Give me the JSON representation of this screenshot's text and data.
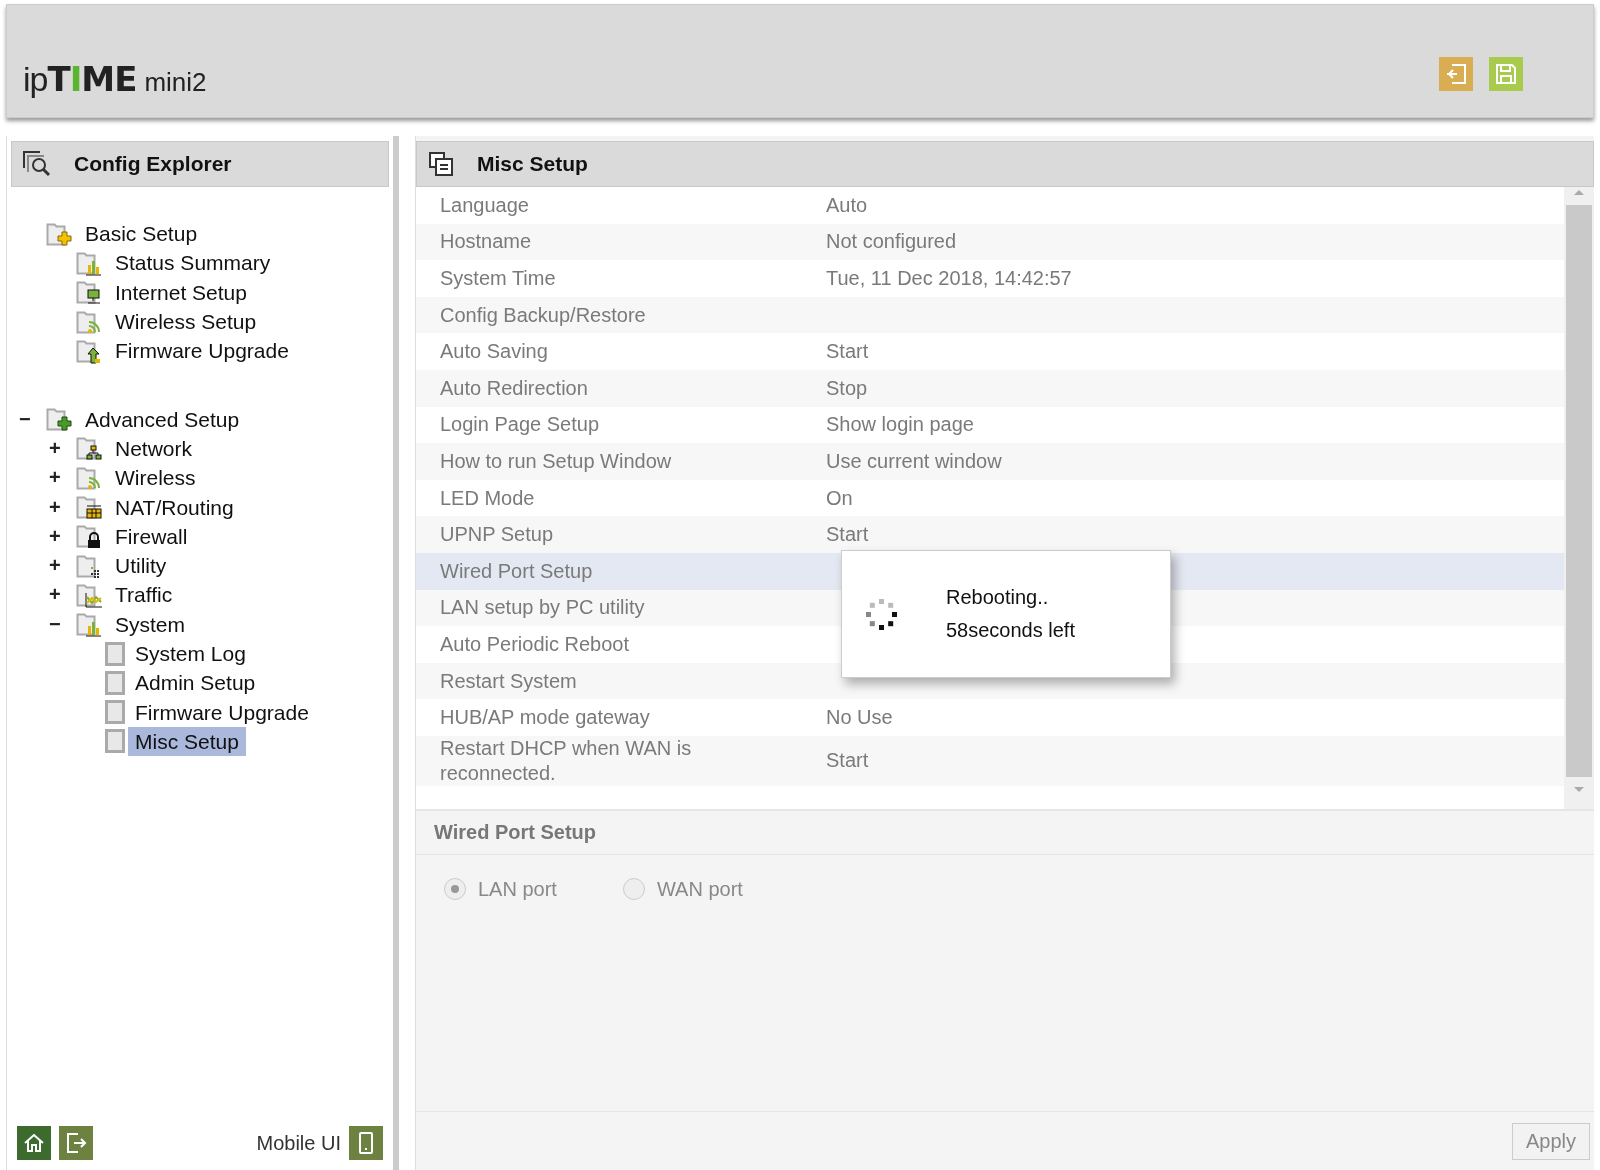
{
  "logo": {
    "prefix": "ip",
    "name": "TIME",
    "model": "mini2"
  },
  "explorer": {
    "title": "Config Explorer",
    "tree": [
      {
        "label": "Basic Setup",
        "kind": "basic",
        "selected": false,
        "children": [
          {
            "label": "Status Summary",
            "kind": "chart",
            "selected": false
          },
          {
            "label": "Internet Setup",
            "kind": "monitor",
            "selected": false
          },
          {
            "label": "Wireless Setup",
            "kind": "signal",
            "selected": false
          },
          {
            "label": "Firmware Upgrade",
            "kind": "upload",
            "selected": false
          }
        ]
      },
      {
        "label": "Advanced Setup",
        "kind": "advanced",
        "selected": false,
        "toggle": "−",
        "children": [
          {
            "label": "Network",
            "kind": "network",
            "selected": false,
            "toggle": "+"
          },
          {
            "label": "Wireless",
            "kind": "signal",
            "selected": false,
            "toggle": "+"
          },
          {
            "label": "NAT/Routing",
            "kind": "nat",
            "selected": false,
            "toggle": "+"
          },
          {
            "label": "Firewall",
            "kind": "lock",
            "selected": false,
            "toggle": "+"
          },
          {
            "label": "Utility",
            "kind": "utility",
            "selected": false,
            "toggle": "+"
          },
          {
            "label": "Traffic",
            "kind": "traffic",
            "selected": false,
            "toggle": "+"
          },
          {
            "label": "System",
            "kind": "chart",
            "selected": false,
            "toggle": "−",
            "children": [
              {
                "label": "System Log",
                "kind": "page",
                "selected": false
              },
              {
                "label": "Admin Setup",
                "kind": "page",
                "selected": false
              },
              {
                "label": "Firmware Upgrade",
                "kind": "page",
                "selected": false
              },
              {
                "label": "Misc Setup",
                "kind": "page",
                "selected": true
              }
            ]
          }
        ]
      }
    ],
    "mobile_label": "Mobile UI"
  },
  "panel": {
    "title": "Misc Setup",
    "rows": [
      {
        "label": "Language",
        "value": "Auto",
        "selected": false
      },
      {
        "label": "Hostname",
        "value": "Not configured",
        "selected": false
      },
      {
        "label": "System Time",
        "value": "Tue, 11 Dec 2018, 14:42:57",
        "selected": false
      },
      {
        "label": "Config Backup/Restore",
        "selected": false
      },
      {
        "label": "Auto Saving",
        "value": "Start",
        "selected": false
      },
      {
        "label": "Auto Redirection",
        "value": "Stop",
        "selected": false
      },
      {
        "label": "Login Page Setup",
        "value": "Show login page",
        "selected": false
      },
      {
        "label": "How to run Setup Window",
        "value": "Use current window",
        "selected": false
      },
      {
        "label": "LED Mode",
        "value": "On",
        "selected": false
      },
      {
        "label": "UPNP Setup",
        "value": "Start",
        "selected": false
      },
      {
        "label": "Wired Port Setup",
        "selected": true
      },
      {
        "label": "LAN setup by PC utility",
        "selected": false
      },
      {
        "label": "Auto Periodic Reboot",
        "selected": false
      },
      {
        "label": "Restart System",
        "selected": false
      },
      {
        "label": "HUB/AP mode gateway",
        "value": "No Use",
        "selected": false
      },
      {
        "label": "Restart DHCP when WAN is reconnected.",
        "value": "Start",
        "selected": false
      }
    ],
    "dialog": {
      "lines": [
        "Rebooting..",
        "58seconds left"
      ]
    },
    "section": {
      "title": "Wired Port Setup",
      "options": [
        {
          "label": "LAN port",
          "selected": true
        },
        {
          "label": "WAN port",
          "selected": false
        }
      ]
    },
    "apply": "Apply"
  }
}
